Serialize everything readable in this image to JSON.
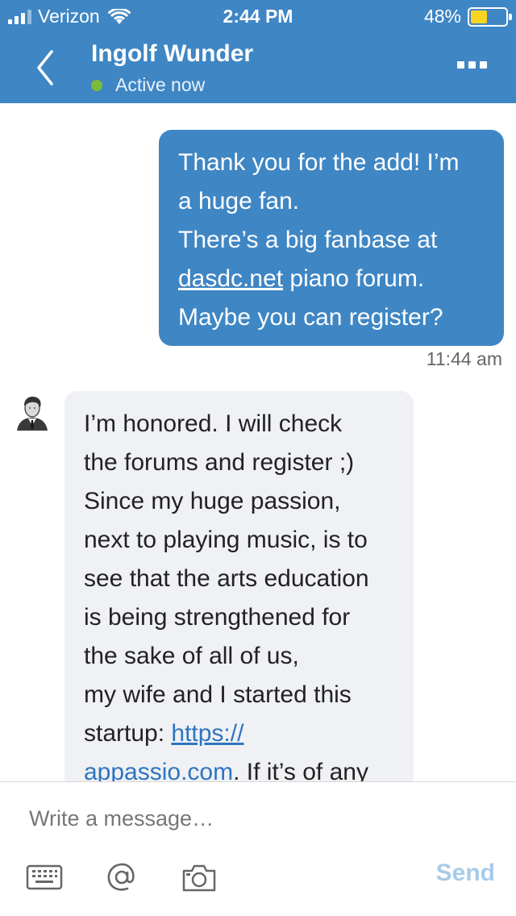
{
  "status_bar": {
    "carrier": "Verizon",
    "time": "2:44 PM",
    "battery": "48%",
    "battery_level": 0.48
  },
  "header": {
    "contact_name": "Ingolf Wunder",
    "presence": "Active now",
    "presence_color": "#7dbb3c",
    "accent": "#3f86c4"
  },
  "messages": [
    {
      "direction": "outgoing",
      "lines": [
        "Thank you for the add! I’m",
        "a huge fan.",
        "There’s a big fanbase at"
      ],
      "link": "dasdc.net",
      "link_tail": " piano forum.",
      "last_line": "Maybe you can register?",
      "timestamp": "11:44 am"
    },
    {
      "direction": "incoming",
      "lines": [
        "I’m honored. I will check",
        "the forums and register ;)",
        "Since my huge passion,",
        "next to playing music, is to",
        "see that the arts education",
        "is being strengthened for",
        "the sake of all of us,",
        "my wife and I started this"
      ],
      "line_9_prefix": "startup: ",
      "link_part1": "https://",
      "link_part2": "appassio.com",
      "line_10_tail": ". If it’s of any"
    }
  ],
  "composer": {
    "placeholder": "Write a message…",
    "send_label": "Send",
    "send_color": "#a7cbe8",
    "tools": [
      "keyboard-icon",
      "at-sign-icon",
      "camera-icon"
    ]
  }
}
